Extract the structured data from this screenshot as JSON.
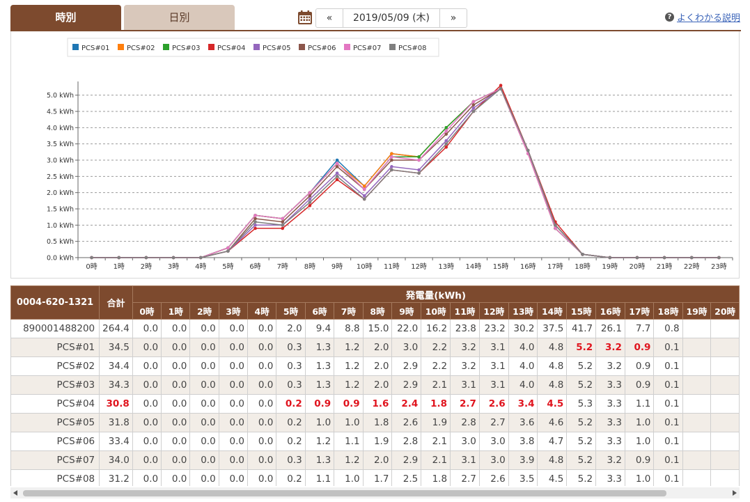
{
  "tabs": {
    "hourly": "時別",
    "daily": "日別"
  },
  "date_nav": {
    "prev": "«",
    "date": "2019/05/09 (木)",
    "next": "»"
  },
  "help": {
    "icon": "?",
    "label": "よくわかる説明"
  },
  "colors": {
    "brand": "#7d4a2e",
    "tab_inactive": "#d9c8bb",
    "highlight": "#e0141e"
  },
  "chart_data": {
    "type": "line",
    "categories": [
      "0時",
      "1時",
      "2時",
      "3時",
      "4時",
      "5時",
      "6時",
      "7時",
      "8時",
      "9時",
      "10時",
      "11時",
      "12時",
      "13時",
      "14時",
      "15時",
      "16時",
      "17時",
      "18時",
      "19時",
      "20時",
      "21時",
      "22時",
      "23時"
    ],
    "y_ticks": [
      "0.0 kWh",
      "0.5 kWh",
      "1.0 kWh",
      "1.5 kWh",
      "2.0 kWh",
      "2.5 kWh",
      "3.0 kWh",
      "3.5 kWh",
      "4.0 kWh",
      "4.5 kWh",
      "5.0 kWh"
    ],
    "ylim": [
      0,
      5.25
    ],
    "grid": true,
    "legend_position": "top",
    "series": [
      {
        "name": "PCS#01",
        "color": "#1f77b4",
        "values": [
          0,
          0,
          0,
          0,
          0,
          0.3,
          1.3,
          1.2,
          2.0,
          3.0,
          2.2,
          3.2,
          3.1,
          4.0,
          4.8,
          5.2,
          3.2,
          0.9,
          0.1,
          0,
          0,
          0,
          0,
          0
        ]
      },
      {
        "name": "PCS#02",
        "color": "#ff7f0e",
        "values": [
          0,
          0,
          0,
          0,
          0,
          0.3,
          1.3,
          1.2,
          2.0,
          2.9,
          2.2,
          3.2,
          3.1,
          4.0,
          4.8,
          5.2,
          3.2,
          0.9,
          0.1,
          0,
          0,
          0,
          0,
          0
        ]
      },
      {
        "name": "PCS#03",
        "color": "#2ca02c",
        "values": [
          0,
          0,
          0,
          0,
          0,
          0.3,
          1.3,
          1.2,
          2.0,
          2.9,
          2.1,
          3.1,
          3.1,
          4.0,
          4.8,
          5.2,
          3.3,
          0.9,
          0.1,
          0,
          0,
          0,
          0,
          0
        ]
      },
      {
        "name": "PCS#04",
        "color": "#d62728",
        "values": [
          0,
          0,
          0,
          0,
          0,
          0.2,
          0.9,
          0.9,
          1.6,
          2.4,
          1.8,
          2.7,
          2.6,
          3.4,
          4.5,
          5.3,
          3.3,
          1.1,
          0.1,
          0,
          0,
          0,
          0,
          0
        ]
      },
      {
        "name": "PCS#05",
        "color": "#9467bd",
        "values": [
          0,
          0,
          0,
          0,
          0,
          0.2,
          1.0,
          1.0,
          1.8,
          2.6,
          1.9,
          2.8,
          2.7,
          3.6,
          4.6,
          5.2,
          3.3,
          1.0,
          0.1,
          0,
          0,
          0,
          0,
          0
        ]
      },
      {
        "name": "PCS#06",
        "color": "#8c564b",
        "values": [
          0,
          0,
          0,
          0,
          0,
          0.2,
          1.2,
          1.1,
          1.9,
          2.8,
          2.1,
          3.0,
          3.0,
          3.8,
          4.7,
          5.2,
          3.3,
          1.0,
          0.1,
          0,
          0,
          0,
          0,
          0
        ]
      },
      {
        "name": "PCS#07",
        "color": "#e377c2",
        "values": [
          0,
          0,
          0,
          0,
          0,
          0.3,
          1.3,
          1.2,
          2.0,
          2.9,
          2.1,
          3.1,
          3.0,
          3.9,
          4.8,
          5.2,
          3.2,
          0.9,
          0.1,
          0,
          0,
          0,
          0,
          0
        ]
      },
      {
        "name": "PCS#08",
        "color": "#7f7f7f",
        "values": [
          0,
          0,
          0,
          0,
          0,
          0.2,
          1.1,
          1.0,
          1.7,
          2.5,
          1.8,
          2.7,
          2.6,
          3.5,
          4.5,
          5.2,
          3.3,
          1.0,
          0.1,
          0,
          0,
          0,
          0,
          0
        ]
      }
    ]
  },
  "table": {
    "id_header": "0004-620-1321",
    "sum_header": "合計",
    "group_header": "発電量(kWh)",
    "hours": [
      "0時",
      "1時",
      "2時",
      "3時",
      "4時",
      "5時",
      "6時",
      "7時",
      "8時",
      "9時",
      "10時",
      "11時",
      "12時",
      "13時",
      "14時",
      "15時",
      "16時",
      "17時",
      "18時",
      "19時",
      "20時"
    ],
    "rows": [
      {
        "label": "890001488200",
        "sum": "264.4",
        "sum_hl": false,
        "cells": [
          "0.0",
          "0.0",
          "0.0",
          "0.0",
          "0.0",
          "2.0",
          "9.4",
          "8.8",
          "15.0",
          "22.0",
          "16.2",
          "23.8",
          "23.2",
          "30.2",
          "37.5",
          "41.7",
          "26.1",
          "7.7",
          "0.8",
          "",
          ""
        ],
        "hl": []
      },
      {
        "label": "PCS#01",
        "sum": "34.5",
        "sum_hl": false,
        "cells": [
          "0.0",
          "0.0",
          "0.0",
          "0.0",
          "0.0",
          "0.3",
          "1.3",
          "1.2",
          "2.0",
          "3.0",
          "2.2",
          "3.2",
          "3.1",
          "4.0",
          "4.8",
          "5.2",
          "3.2",
          "0.9",
          "0.1",
          "",
          ""
        ],
        "hl": [
          15,
          16,
          17
        ]
      },
      {
        "label": "PCS#02",
        "sum": "34.4",
        "sum_hl": false,
        "cells": [
          "0.0",
          "0.0",
          "0.0",
          "0.0",
          "0.0",
          "0.3",
          "1.3",
          "1.2",
          "2.0",
          "2.9",
          "2.2",
          "3.2",
          "3.1",
          "4.0",
          "4.8",
          "5.2",
          "3.2",
          "0.9",
          "0.1",
          "",
          ""
        ],
        "hl": []
      },
      {
        "label": "PCS#03",
        "sum": "34.3",
        "sum_hl": false,
        "cells": [
          "0.0",
          "0.0",
          "0.0",
          "0.0",
          "0.0",
          "0.3",
          "1.3",
          "1.2",
          "2.0",
          "2.9",
          "2.1",
          "3.1",
          "3.1",
          "4.0",
          "4.8",
          "5.2",
          "3.3",
          "0.9",
          "0.1",
          "",
          ""
        ],
        "hl": []
      },
      {
        "label": "PCS#04",
        "sum": "30.8",
        "sum_hl": true,
        "cells": [
          "0.0",
          "0.0",
          "0.0",
          "0.0",
          "0.0",
          "0.2",
          "0.9",
          "0.9",
          "1.6",
          "2.4",
          "1.8",
          "2.7",
          "2.6",
          "3.4",
          "4.5",
          "5.3",
          "3.3",
          "1.1",
          "0.1",
          "",
          ""
        ],
        "hl": [
          5,
          6,
          7,
          8,
          9,
          10,
          11,
          12,
          13,
          14
        ]
      },
      {
        "label": "PCS#05",
        "sum": "31.8",
        "sum_hl": false,
        "cells": [
          "0.0",
          "0.0",
          "0.0",
          "0.0",
          "0.0",
          "0.2",
          "1.0",
          "1.0",
          "1.8",
          "2.6",
          "1.9",
          "2.8",
          "2.7",
          "3.6",
          "4.6",
          "5.2",
          "3.3",
          "1.0",
          "0.1",
          "",
          ""
        ],
        "hl": []
      },
      {
        "label": "PCS#06",
        "sum": "33.4",
        "sum_hl": false,
        "cells": [
          "0.0",
          "0.0",
          "0.0",
          "0.0",
          "0.0",
          "0.2",
          "1.2",
          "1.1",
          "1.9",
          "2.8",
          "2.1",
          "3.0",
          "3.0",
          "3.8",
          "4.7",
          "5.2",
          "3.3",
          "1.0",
          "0.1",
          "",
          ""
        ],
        "hl": []
      },
      {
        "label": "PCS#07",
        "sum": "34.0",
        "sum_hl": false,
        "cells": [
          "0.0",
          "0.0",
          "0.0",
          "0.0",
          "0.0",
          "0.3",
          "1.3",
          "1.2",
          "2.0",
          "2.9",
          "2.1",
          "3.1",
          "3.0",
          "3.9",
          "4.8",
          "5.2",
          "3.2",
          "0.9",
          "0.1",
          "",
          ""
        ],
        "hl": []
      },
      {
        "label": "PCS#08",
        "sum": "31.2",
        "sum_hl": false,
        "cells": [
          "0.0",
          "0.0",
          "0.0",
          "0.0",
          "0.0",
          "0.2",
          "1.1",
          "1.0",
          "1.7",
          "2.5",
          "1.8",
          "2.7",
          "2.6",
          "3.5",
          "4.5",
          "5.2",
          "3.3",
          "1.0",
          "0.1",
          "",
          ""
        ],
        "hl": []
      }
    ]
  }
}
